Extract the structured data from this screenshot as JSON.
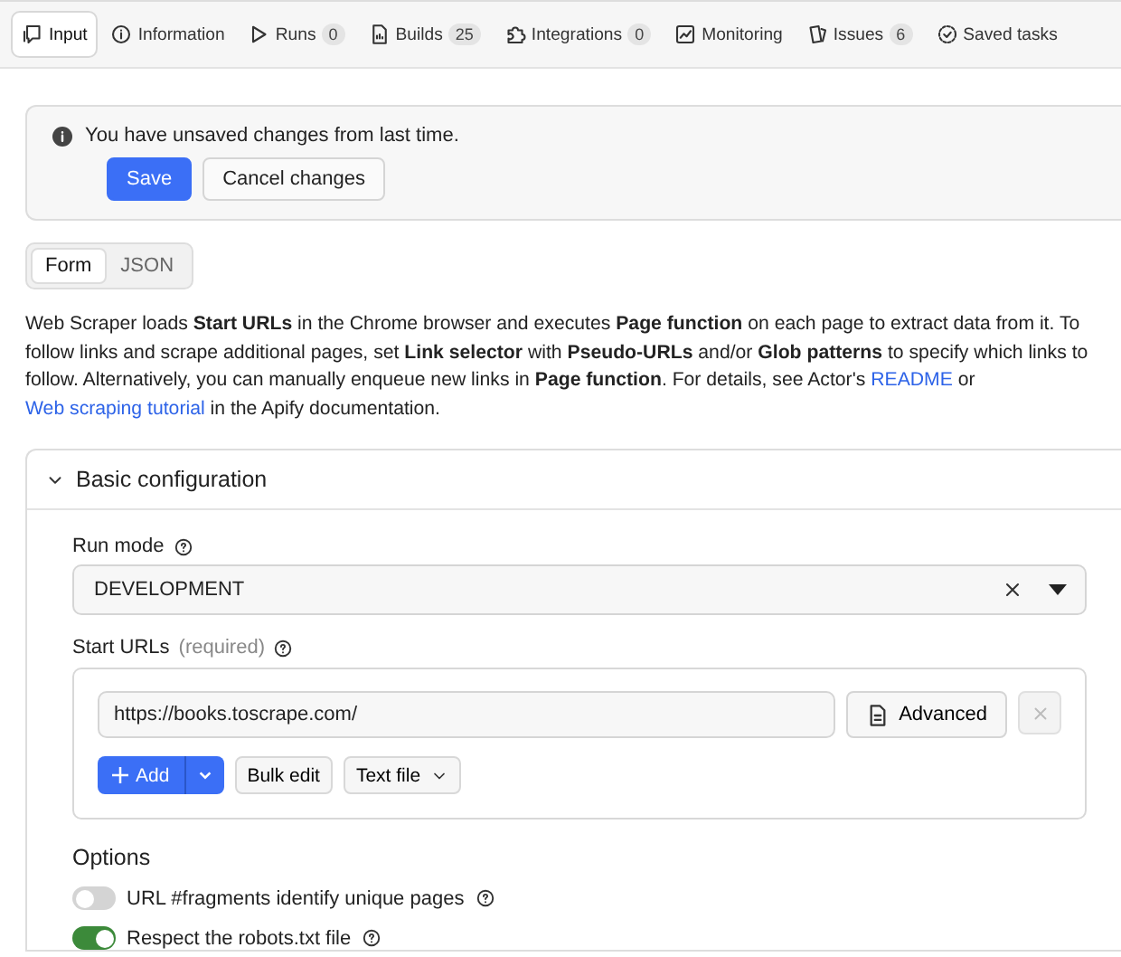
{
  "tabs": [
    {
      "label": "Input",
      "selected": true
    },
    {
      "label": "Information",
      "selected": false
    },
    {
      "label": "Runs",
      "count": "0",
      "selected": false
    },
    {
      "label": "Builds",
      "count": "25",
      "selected": false
    },
    {
      "label": "Integrations",
      "count": "0",
      "selected": false
    },
    {
      "label": "Monitoring",
      "selected": false
    },
    {
      "label": "Issues",
      "count": "6",
      "selected": false
    },
    {
      "label": "Saved tasks",
      "selected": false
    }
  ],
  "banner": {
    "message": "You have unsaved changes from last time.",
    "buttons": [
      {
        "label": "Save",
        "kind": "primary"
      },
      {
        "label": "Cancel changes",
        "kind": "secondary"
      }
    ]
  },
  "view_toggle": [
    {
      "label": "Form",
      "selected": true
    },
    {
      "label": "JSON",
      "selected": false
    }
  ],
  "description": [
    {
      "kind": "text",
      "text": "Web Scraper loads **Start URLs** in the Chrome browser and executes **Page function** on each page to extract data from it. To follow links and scrape additional pages, set **Link selector** with **Pseudo-URLs** and/or **Glob patterns** to specify which links to follow. Alternatively, you can manually enqueue new links in **Page function**. For details, see Actor's "
    },
    {
      "kind": "link",
      "text": "README"
    },
    {
      "kind": "text",
      "text": " or "
    },
    {
      "kind": "link",
      "text": "Web scraping tutorial"
    },
    {
      "kind": "text",
      "text": " in the Apify documentation."
    }
  ],
  "section": {
    "title": "Basic configuration",
    "expanded": true,
    "run_mode": {
      "label": "Run mode",
      "value": "DEVELOPMENT"
    },
    "start_urls": {
      "label": "Start URLs",
      "note": "(required)",
      "urls": [
        "https://books.toscrape.com/"
      ],
      "advanced_button": "Advanced",
      "add_button": "Add",
      "bulk_edit_button": "Bulk edit",
      "text_file_button": "Text file"
    },
    "options": {
      "title": "Options",
      "toggles": [
        {
          "label": "URL #fragments identify unique pages",
          "on": false
        },
        {
          "label": "Respect the robots.txt file",
          "on": true
        }
      ]
    }
  }
}
